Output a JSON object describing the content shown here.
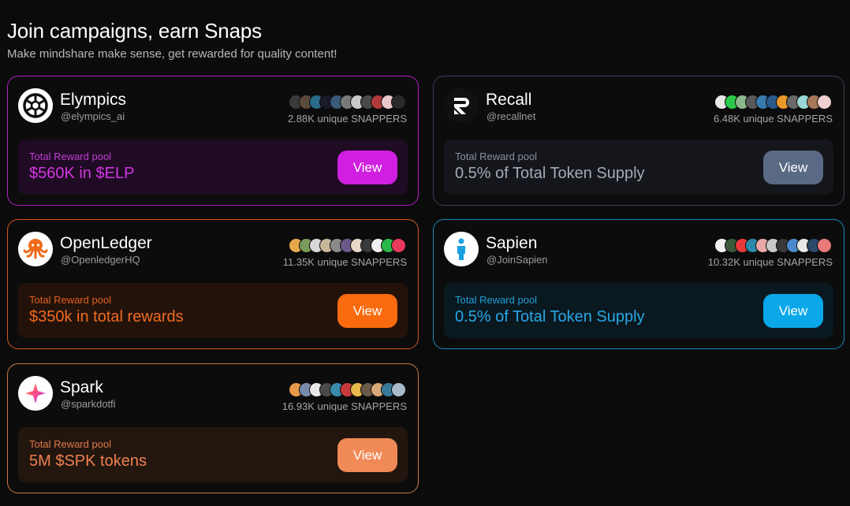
{
  "page": {
    "title": "Join campaigns, earn Snaps",
    "subtitle": "Make mindshare make sense, get rewarded for quality content!"
  },
  "campaigns": [
    {
      "name": "Elympics",
      "handle": "@elympics_ai",
      "snappers": "2.88K unique SNAPPERS",
      "pool_label": "Total Reward pool",
      "pool_value": "$560K in $ELP",
      "view_label": "View",
      "colors": {
        "border": "#b01fc4",
        "pool_bg": "#1f0b23",
        "label": "#c23cd4",
        "value": "#d535e6",
        "button": "#d01fe0"
      },
      "avatar_colors": [
        "#3a3a3a",
        "#5a4a3a",
        "#2a6a8a",
        "#1a1a2a",
        "#3a5a7a",
        "#7a7a7a",
        "#c8c8c8",
        "#4a4a4a",
        "#b03a3a",
        "#e8c8c8",
        "#2a2a2a"
      ]
    },
    {
      "name": "Recall",
      "handle": "@recallnet",
      "snappers": "6.48K unique SNAPPERS",
      "pool_label": "Total Reward pool",
      "pool_value": "0.5% of Total Token Supply",
      "view_label": "View",
      "colors": {
        "border": "#3a3e55",
        "pool_bg": "#15161b",
        "label": "#8a8f9c",
        "value": "#a5aab5",
        "button": "#5a6a84"
      },
      "avatar_colors": [
        "#e8e8e8",
        "#2ac84a",
        "#8ab88a",
        "#5a5a5a",
        "#3a7aaa",
        "#2a5a8a",
        "#e89a2a",
        "#6a6a6a",
        "#9ad8d8",
        "#a87a5a",
        "#f0d0d0"
      ]
    },
    {
      "name": "OpenLedger",
      "handle": "@OpenledgerHQ",
      "snappers": "11.35K unique SNAPPERS",
      "pool_label": "Total Reward pool",
      "pool_value": "$350k in total rewards",
      "view_label": "View",
      "colors": {
        "border": "#d2581a",
        "pool_bg": "#231209",
        "label": "#e2601e",
        "value": "#f06a22",
        "button": "#fa6a0f"
      },
      "avatar_colors": [
        "#e8a84a",
        "#7a9a5a",
        "#d8d8d8",
        "#c8b89a",
        "#8a8a8a",
        "#6a5a8a",
        "#e8d8c8",
        "#3a3a3a",
        "#f0f0f0",
        "#2ab84a",
        "#e83a5a"
      ]
    },
    {
      "name": "Sapien",
      "handle": "@JoinSapien",
      "snappers": "10.32K unique SNAPPERS",
      "pool_label": "Total Reward pool",
      "pool_value": "0.5% of Total Token Supply",
      "view_label": "View",
      "colors": {
        "border": "#1a88b8",
        "pool_bg": "#0a1820",
        "label": "#20a0d8",
        "value": "#28a8e4",
        "button": "#0aa8e8"
      },
      "avatar_colors": [
        "#f0f0f0",
        "#3a5a3a",
        "#e83a3a",
        "#2a8aaa",
        "#e8a8a8",
        "#c8c8c8",
        "#3a3a3a",
        "#4a8aca",
        "#e8e8e8",
        "#2a4a6a",
        "#e87a7a"
      ]
    },
    {
      "name": "Spark",
      "handle": "@sparkdotfi",
      "snappers": "16.93K unique SNAPPERS",
      "pool_label": "Total Reward pool",
      "pool_value": "5M $SPK tokens",
      "view_label": "View",
      "colors": {
        "border": "#c8784a",
        "pool_bg": "#22160f",
        "label": "#e07848",
        "value": "#f08050",
        "button": "#f08a56"
      },
      "avatar_colors": [
        "#e8984a",
        "#7a8aaa",
        "#e8e8e8",
        "#4a4a4a",
        "#3a8aaa",
        "#c83a3a",
        "#e8b84a",
        "#6a5a4a",
        "#d8a87a",
        "#3a7a9a",
        "#aabbcc"
      ]
    }
  ]
}
